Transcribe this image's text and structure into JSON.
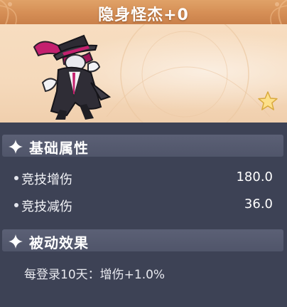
{
  "title": "隐身怪杰+0",
  "icons": {
    "character": "costume-character-illustration",
    "star": "star-icon",
    "section": "sparkle-icon"
  },
  "colors": {
    "header": "#d58e55",
    "hero_bg": "#f5d9bb",
    "panel_bg": "#3d4255",
    "section_bg": "#5b6075",
    "accent_magenta": "#c4206e",
    "star": "#fde08a"
  },
  "basic_attributes": {
    "heading": "基础属性",
    "stats": [
      {
        "name": "竞技增伤",
        "value": "180.0"
      },
      {
        "name": "竞技减伤",
        "value": "36.0"
      }
    ]
  },
  "passive_effect": {
    "heading": "被动效果",
    "text": "每登录10天：增伤+1.0%"
  }
}
